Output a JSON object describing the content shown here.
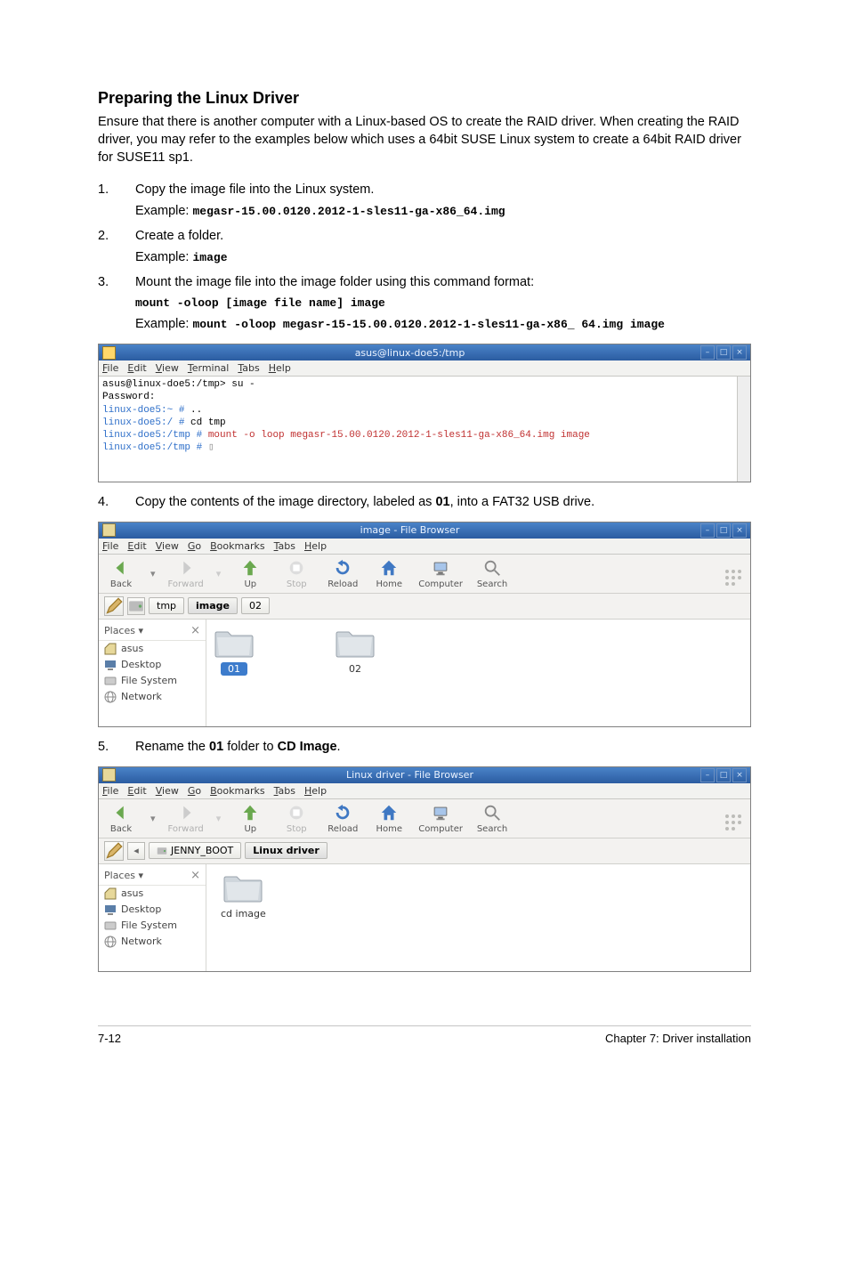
{
  "heading": "Preparing the Linux Driver",
  "intro": "Ensure that there is another computer with a Linux-based OS to create the RAID driver. When creating the RAID driver, you may refer to the examples below which uses a 64bit SUSE Linux system to create a 64bit RAID driver for SUSE11 sp1.",
  "steps": {
    "s1": {
      "num": "1.",
      "text": "Copy the image file into the Linux system.",
      "example_label": "Example: ",
      "example_code": "megasr-15.00.0120.2012-1-sles11-ga-x86_64.img"
    },
    "s2": {
      "num": "2.",
      "text": "Create a folder.",
      "example_label": "Example: ",
      "example_code": "image"
    },
    "s3": {
      "num": "3.",
      "text": "Mount the image file into the image folder using this command format:",
      "cmd": "mount -oloop [image file name] image",
      "example_label": "Example: ",
      "example_code": "mount  -oloop  megasr-15-15.00.0120.2012-1-sles11-ga-x86_ 64.img image"
    },
    "s4": {
      "num": "4.",
      "text_before": "Copy the contents of the image directory, labeled as ",
      "bold1": "01",
      "text_after": ", into  a FAT32 USB drive."
    },
    "s5": {
      "num": "5.",
      "text_before": "Rename the ",
      "bold1": "01",
      "text_mid": " folder to ",
      "bold2": "CD Image",
      "text_after": "."
    }
  },
  "terminal": {
    "title": "asus@linux-doe5:/tmp",
    "menu": [
      "File",
      "Edit",
      "View",
      "Terminal",
      "Tabs",
      "Help"
    ],
    "lines": [
      {
        "cls": "",
        "t": "asus@linux-doe5:/tmp> su -"
      },
      {
        "cls": "",
        "t": "Password:"
      },
      {
        "cls": "prompt-blue",
        "t": "linux-doe5:~ # ",
        "rest": ".."
      },
      {
        "cls": "prompt-blue",
        "t": "linux-doe5:/ # ",
        "rest": "cd tmp"
      },
      {
        "cls": "prompt-blue",
        "t": "linux-doe5:/tmp # ",
        "restcls": "prompt-red",
        "rest": "mount -o loop megasr-15.00.0120.2012-1-sles11-ga-x86_64.img image"
      },
      {
        "cls": "prompt-blue",
        "t": "linux-doe5:/tmp # ",
        "rest": ""
      }
    ]
  },
  "fb_common": {
    "menu": [
      "File",
      "Edit",
      "View",
      "Go",
      "Bookmarks",
      "Tabs",
      "Help"
    ],
    "toolbar": {
      "back": "Back",
      "forward": "Forward",
      "up": "Up",
      "stop": "Stop",
      "reload": "Reload",
      "home": "Home",
      "computer": "Computer",
      "search": "Search"
    },
    "side": {
      "header": "Places",
      "close": "×",
      "items": [
        "asus",
        "Desktop",
        "File System",
        "Network"
      ]
    }
  },
  "fb1": {
    "title": "image - File Browser",
    "path": {
      "segs": [
        "tmp",
        "image",
        "02"
      ],
      "sel": 1,
      "leading": "disk"
    },
    "files": [
      {
        "name": "01",
        "selected": true
      },
      {
        "name": "02",
        "selected": false
      }
    ]
  },
  "fb2": {
    "title": "Linux driver - File Browser",
    "path": {
      "segs": [
        "JENNY_BOOT",
        "Linux driver"
      ],
      "sel": 1,
      "leading": "back"
    },
    "files": [
      {
        "name": "cd image",
        "selected": false
      }
    ]
  },
  "footer": {
    "left": "7-12",
    "right": "Chapter 7: Driver installation"
  }
}
